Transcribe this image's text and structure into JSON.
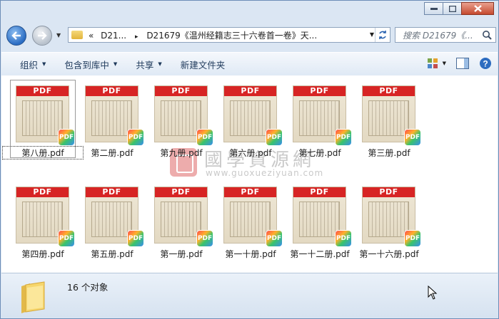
{
  "window": {
    "caption_buttons": [
      "minimize",
      "maximize",
      "close"
    ]
  },
  "address_bar": {
    "prefix": "«",
    "crumb1": "D21...",
    "separator": "▸",
    "crumb2": "D21679《温州经籍志三十六卷首一卷》天...",
    "search_placeholder": "搜索 D21679《..."
  },
  "toolbar": {
    "organize": "组织",
    "include_library": "包含到库中",
    "share": "共享",
    "new_folder": "新建文件夹"
  },
  "files": [
    {
      "name": "第八册.pdf",
      "selected": true
    },
    {
      "name": "第二册.pdf"
    },
    {
      "name": "第九册.pdf"
    },
    {
      "name": "第六册.pdf"
    },
    {
      "name": "第七册.pdf"
    },
    {
      "name": "第三册.pdf"
    },
    {
      "name": "第四册.pdf"
    },
    {
      "name": "第五册.pdf"
    },
    {
      "name": "第一册.pdf"
    },
    {
      "name": "第一十册.pdf"
    },
    {
      "name": "第一十二册.pdf"
    },
    {
      "name": "第一十六册.pdf"
    }
  ],
  "thumb_band_label": "PDF",
  "thumb_badge_label": "PDF",
  "watermark": {
    "text": "國學資源網",
    "url": "www.guoxueziyuan.com"
  },
  "status": {
    "count_text": "16 个对象"
  },
  "colors": {
    "pdf_band": "#d72424",
    "toolbar_text": "#1e395b",
    "window_frame": "#dbe6f3"
  }
}
